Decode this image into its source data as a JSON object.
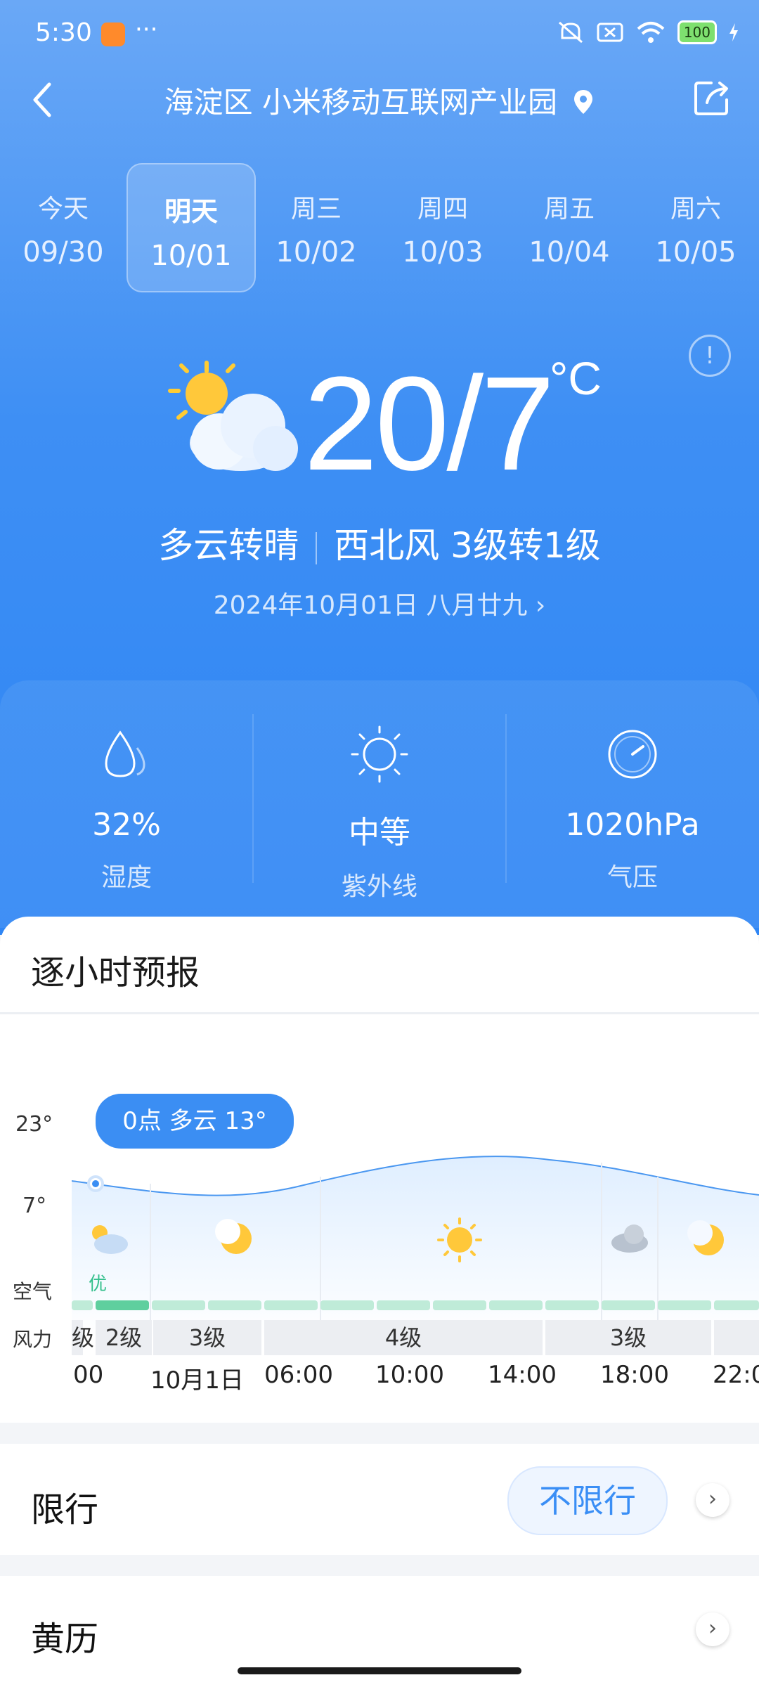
{
  "status_bar": {
    "time": "5:30",
    "more": "···",
    "battery": "100"
  },
  "header": {
    "location": "海淀区 小米移动互联网产业园"
  },
  "days": [
    {
      "name": "今天",
      "date": "09/30",
      "active": false
    },
    {
      "name": "明天",
      "date": "10/01",
      "active": true
    },
    {
      "name": "周三",
      "date": "10/02",
      "active": false
    },
    {
      "name": "周四",
      "date": "10/03",
      "active": false
    },
    {
      "name": "周五",
      "date": "10/04",
      "active": false
    },
    {
      "name": "周六",
      "date": "10/05",
      "active": false
    }
  ],
  "current": {
    "temp_range": "20/7",
    "unit": "°C",
    "condition": "多云转晴",
    "wind": "西北风 3级转1级",
    "date": "2024年10月01日 八月廿九 ›"
  },
  "stats": {
    "humidity": {
      "value": "32%",
      "label": "湿度"
    },
    "uv": {
      "value": "中等",
      "label": "紫外线"
    },
    "pressure": {
      "value": "1020hPa",
      "label": "气压"
    }
  },
  "hourly": {
    "title": "逐小时预报",
    "y_high": "23°",
    "y_low": "7°",
    "air_row_label": "空气",
    "wind_row_label": "风力",
    "tooltip": "0点 多云 13°",
    "air_quality": "优",
    "wind_cells": [
      "级",
      "2级",
      "3级",
      "4级",
      "3级"
    ],
    "times": [
      "00",
      "10月1日",
      "06:00",
      "10:00",
      "14:00",
      "18:00",
      "22:0"
    ]
  },
  "restriction": {
    "title": "限行",
    "value": "不限行"
  },
  "almanac": {
    "title": "黄历"
  },
  "colors": {
    "accent": "#3b8ef3",
    "air_good": "#35c08d",
    "hero_top": "#6aa8f6",
    "hero_bottom": "#2f86f5"
  }
}
